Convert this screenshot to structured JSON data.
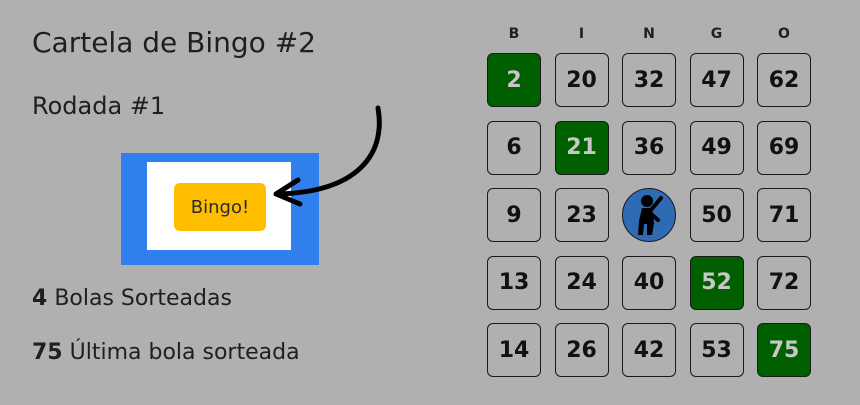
{
  "card_title": "Cartela de Bingo #2",
  "round_title": "Rodada #1",
  "bingo_button_label": "Bingo!",
  "stats": {
    "balls_drawn_value": "4",
    "balls_drawn_label": "Bolas Sorteadas",
    "last_ball_value": "75",
    "last_ball_label": "Última bola sorteada"
  },
  "card": {
    "headers": [
      "B",
      "I",
      "N",
      "G",
      "O"
    ],
    "rows": [
      [
        {
          "v": "2",
          "m": true
        },
        {
          "v": "20",
          "m": false
        },
        {
          "v": "32",
          "m": false
        },
        {
          "v": "47",
          "m": false
        },
        {
          "v": "62",
          "m": false
        }
      ],
      [
        {
          "v": "6",
          "m": false
        },
        {
          "v": "21",
          "m": true
        },
        {
          "v": "36",
          "m": false
        },
        {
          "v": "49",
          "m": false
        },
        {
          "v": "69",
          "m": false
        }
      ],
      [
        {
          "v": "9",
          "m": false
        },
        {
          "v": "23",
          "m": false
        },
        {
          "v": "FREE",
          "m": true,
          "free": true
        },
        {
          "v": "50",
          "m": false
        },
        {
          "v": "71",
          "m": false
        }
      ],
      [
        {
          "v": "13",
          "m": false
        },
        {
          "v": "24",
          "m": false
        },
        {
          "v": "40",
          "m": false
        },
        {
          "v": "52",
          "m": true
        },
        {
          "v": "72",
          "m": false
        }
      ],
      [
        {
          "v": "14",
          "m": false
        },
        {
          "v": "26",
          "m": false
        },
        {
          "v": "42",
          "m": false
        },
        {
          "v": "53",
          "m": false
        },
        {
          "v": "75",
          "m": true
        }
      ]
    ]
  },
  "colors": {
    "background": "#b0b0b0",
    "marked_cell": "#006000",
    "free_space": "#2f6ab5",
    "button": "#ffbf00",
    "frame": "#2f7fed"
  },
  "icons": {
    "free_space": "person-pointing-icon",
    "pointer": "curved-arrow-icon"
  }
}
